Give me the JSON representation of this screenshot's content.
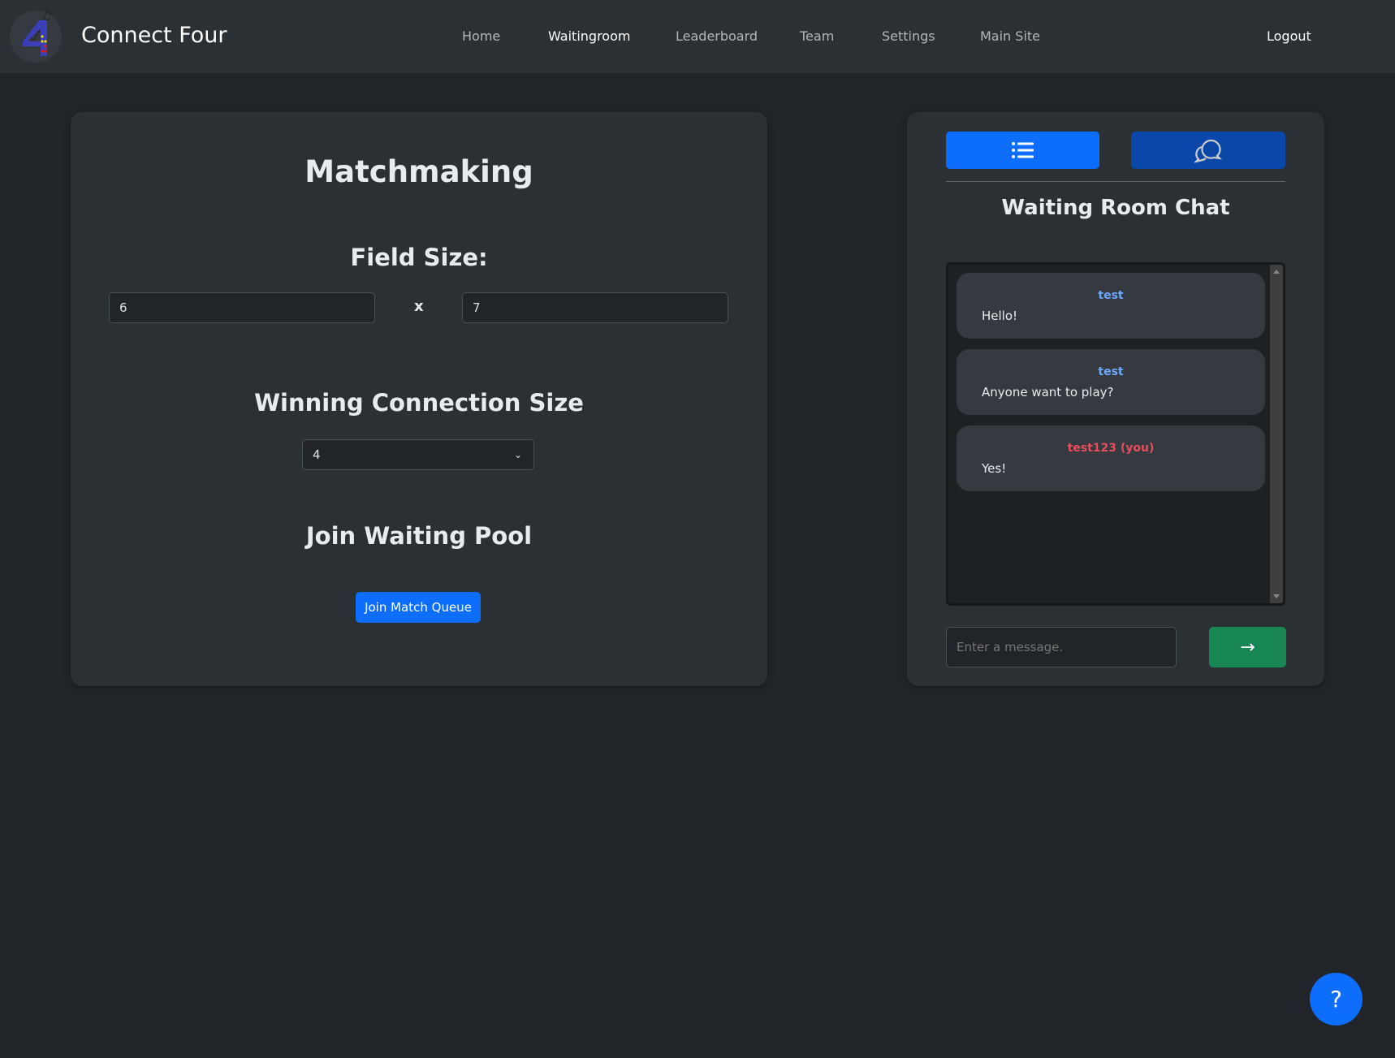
{
  "nav": {
    "brand": "Connect Four",
    "logo_text": "CONNECT 4",
    "links": [
      "Home",
      "Waitingroom",
      "Leaderboard",
      "Team",
      "Settings",
      "Main Site"
    ],
    "active": "Waitingroom",
    "logout": "Logout"
  },
  "matchmaking": {
    "title": "Matchmaking",
    "field_size_label": "Field Size:",
    "rows": "6",
    "times": "x",
    "cols": "7",
    "winning_label": "Winning Connection Size",
    "winning_value": "4",
    "pool_label": "Join Waiting Pool",
    "join_button": "Join Match Queue"
  },
  "chat": {
    "title": "Waiting Room Chat",
    "tab_list_icon": "list-icon",
    "tab_chat_icon": "chat-bubbles-icon",
    "messages": [
      {
        "user": "test",
        "text": "Hello!",
        "color": "#6ea8fe"
      },
      {
        "user": "test",
        "text": "Anyone want to play?",
        "color": "#6ea8fe"
      },
      {
        "user": "test123 (you)",
        "text": "Yes!",
        "color": "#ea4d5b"
      }
    ],
    "input_placeholder": "Enter a message.",
    "send_icon": "arrow-right-icon",
    "send_label": "→"
  },
  "help": {
    "label": "?"
  },
  "colors": {
    "primary": "#0d6efd",
    "primary_dark": "#0a47a9",
    "success": "#198754"
  }
}
